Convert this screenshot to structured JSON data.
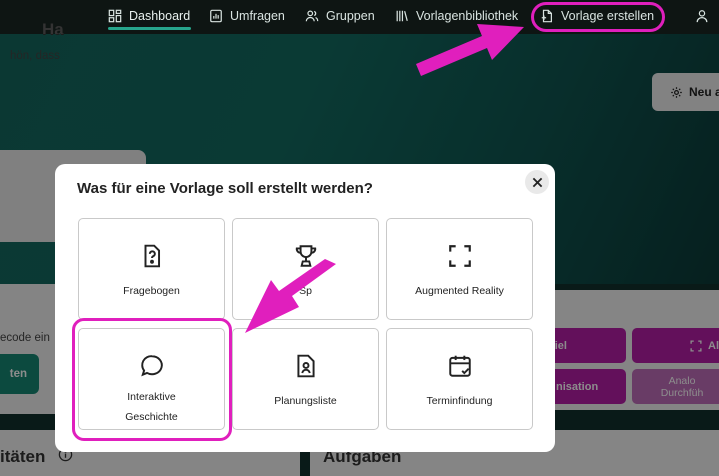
{
  "nav": {
    "items": [
      {
        "label": "Dashboard",
        "icon": "dashboard-icon",
        "active": true
      },
      {
        "label": "Umfragen",
        "icon": "survey-icon"
      },
      {
        "label": "Gruppen",
        "icon": "users-icon"
      },
      {
        "label": "Vorlagenbibliothek",
        "icon": "library-icon"
      },
      {
        "label": "Vorlage erstellen",
        "icon": "add-file-icon"
      }
    ],
    "profile_icon": "user-icon"
  },
  "background": {
    "neu_button": "Neu a",
    "greeting_title": "Ha",
    "greeting_sub": "hön, dass",
    "code_label": "ecode ein",
    "start_button": "ten",
    "aktivitaeten": "itäten",
    "aufgaben": "Aufgaben",
    "panel_buttons": [
      {
        "label": "piel"
      },
      {
        "label": "Al"
      },
      {
        "label": "nisation"
      },
      {
        "line1": "Analo",
        "line2": "Durchfüh"
      }
    ]
  },
  "modal": {
    "title": "Was für eine Vorlage soll erstellt werden?",
    "options": [
      {
        "label": "Fragebogen",
        "icon": "question-file-icon"
      },
      {
        "label": "Sp",
        "icon": "trophy-icon"
      },
      {
        "label": "Augmented Reality",
        "icon": "scan-frame-icon"
      },
      {
        "line1": "Interaktive",
        "line2": "Geschichte",
        "icon": "chat-bubble-icon"
      },
      {
        "label": "Planungsliste",
        "icon": "person-file-icon"
      },
      {
        "label": "Terminfindung",
        "icon": "calendar-check-icon"
      }
    ]
  },
  "colors": {
    "accent_teal": "#27a58c",
    "highlight_magenta": "#e01fbd",
    "panel_button": "#b51ea6"
  }
}
